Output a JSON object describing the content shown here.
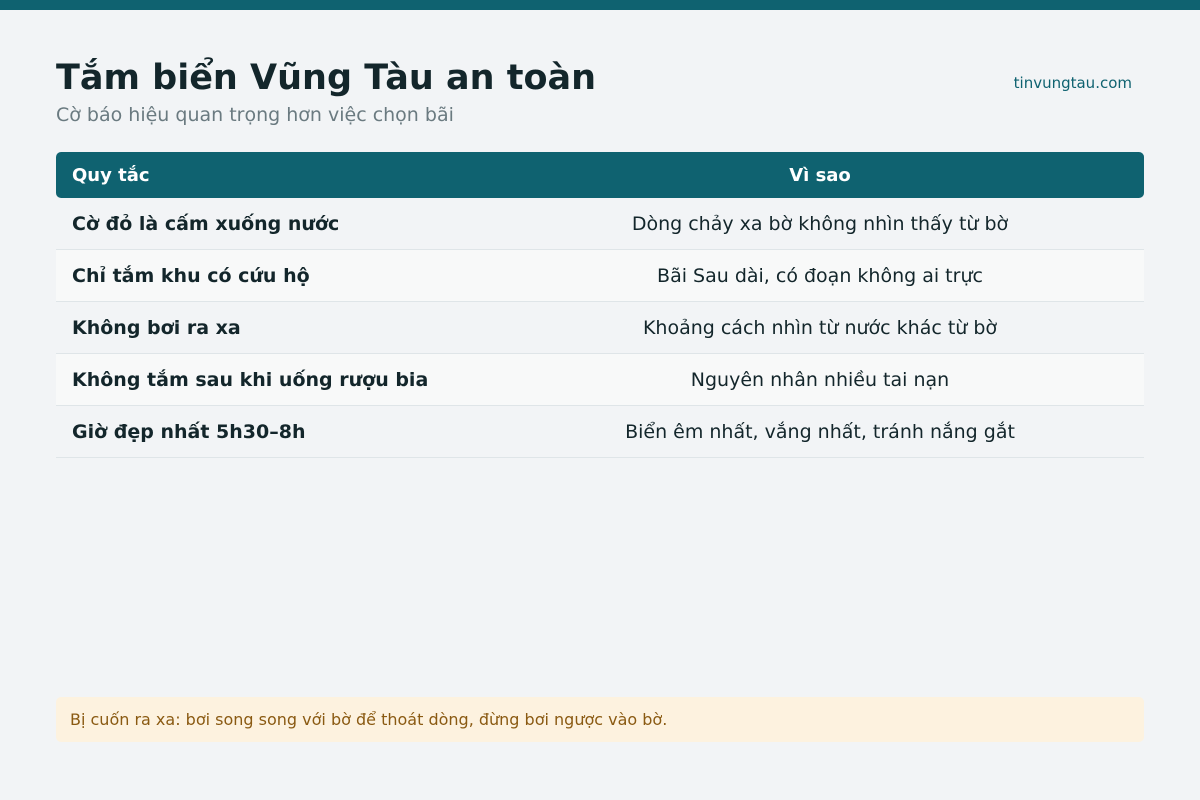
{
  "page": {
    "title": "Tắm biển Vũng Tàu an toàn",
    "subtitle": "Cờ báo hiệu quan trọng hơn việc chọn bãi",
    "site": "tinvungtau.com"
  },
  "table": {
    "headers": {
      "rule": "Quy tắc",
      "why": "Vì sao"
    },
    "rows": [
      {
        "rule": "Cờ đỏ là cấm xuống nước",
        "why": "Dòng chảy xa bờ không nhìn thấy từ bờ"
      },
      {
        "rule": "Chỉ tắm khu có cứu hộ",
        "why": "Bãi Sau dài, có đoạn không ai trực"
      },
      {
        "rule": "Không bơi ra xa",
        "why": "Khoảng cách nhìn từ nước khác từ bờ"
      },
      {
        "rule": "Không tắm sau khi uống rượu bia",
        "why": "Nguyên nhân nhiều tai nạn"
      },
      {
        "rule": "Giờ đẹp nhất 5h30–8h",
        "why": "Biển êm nhất, vắng nhất, tránh nắng gắt"
      }
    ]
  },
  "note": {
    "text": "Bị cuốn ra xa: bơi song song với bờ để thoát dòng, đừng bơi ngược vào bờ."
  },
  "colors": {
    "accent": "#0f6270",
    "background": "#f2f4f6",
    "note_background": "#fdf2df",
    "note_text": "#8a5a12"
  }
}
